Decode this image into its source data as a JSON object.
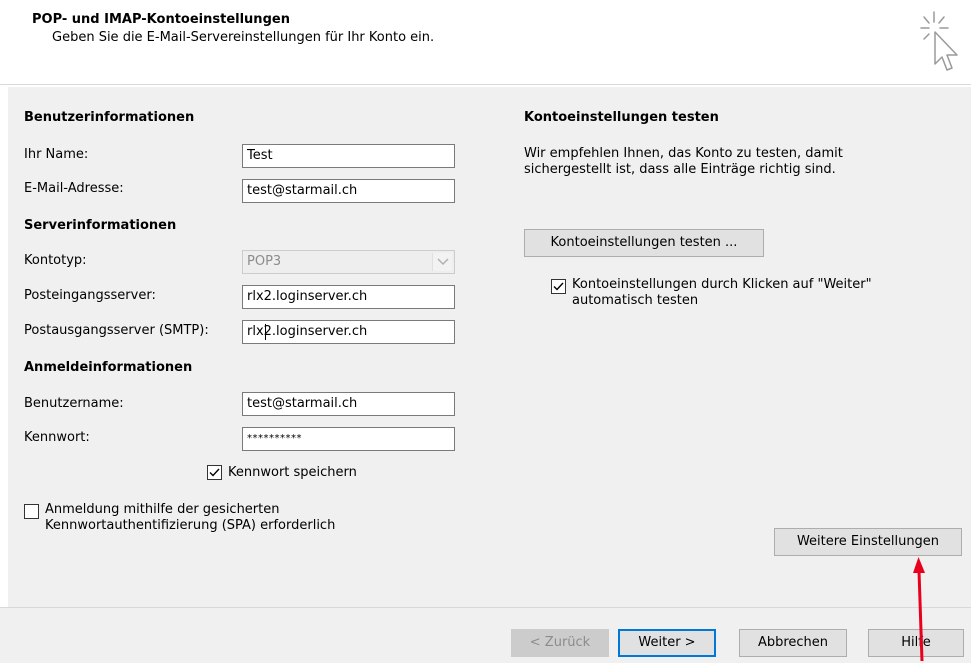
{
  "header": {
    "title": "POP- und IMAP-Kontoeinstellungen",
    "subtitle": "Geben Sie die E-Mail-Servereinstellungen für Ihr Konto ein.",
    "icon": "wizard-cursor-icon"
  },
  "user_info": {
    "heading": "Benutzerinformationen",
    "name_label": "Ihr Name:",
    "name_value": "Test",
    "email_label": "E-Mail-Adresse:",
    "email_value": "test@starmail.ch"
  },
  "server_info": {
    "heading": "Serverinformationen",
    "account_type_label": "Kontotyp:",
    "account_type_value": "POP3",
    "incoming_label": "Posteingangsserver:",
    "incoming_value": "rlx2.loginserver.ch",
    "outgoing_label": "Postausgangsserver (SMTP):",
    "outgoing_value": "rlx2.loginserver.ch"
  },
  "login_info": {
    "heading": "Anmeldeinformationen",
    "username_label": "Benutzername:",
    "username_value": "test@starmail.ch",
    "password_label": "Kennwort:",
    "password_value": "**********",
    "remember_label": "Kennwort speichern",
    "remember_checked": true,
    "spa_label_line1": "Anmeldung mithilfe der gesicherten",
    "spa_label_line2": "Kennwortauthentifizierung (SPA) erforderlich",
    "spa_checked": false
  },
  "test_section": {
    "heading": "Kontoeinstellungen testen",
    "description_line1": "Wir empfehlen Ihnen, das Konto zu testen, damit",
    "description_line2": "sichergestellt ist, dass alle Einträge richtig sind.",
    "test_button": "Kontoeinstellungen testen ...",
    "auto_test_line1": "Kontoeinstellungen durch Klicken auf \"Weiter\"",
    "auto_test_line2": "automatisch testen",
    "auto_test_checked": true
  },
  "more_settings_button": "Weitere Einstellungen",
  "footer": {
    "back_button": "< Zurück",
    "next_button": "Weiter >",
    "cancel_button": "Abbrechen",
    "help_button": "Hilfe"
  },
  "colors": {
    "accent": "#0078d7",
    "annotation_arrow": "#e8001c"
  }
}
